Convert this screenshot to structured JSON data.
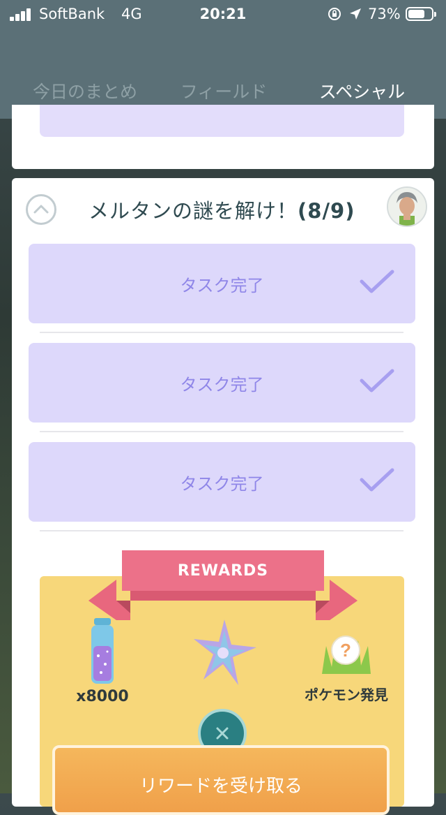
{
  "status_bar": {
    "carrier": "SoftBank",
    "network": "4G",
    "time": "20:21",
    "battery_percent": "73%",
    "battery_level": 0.73
  },
  "tabs": [
    {
      "label": "今日のまとめ",
      "active": false
    },
    {
      "label": "フィールド",
      "active": false
    },
    {
      "label": "スペシャル",
      "active": true
    }
  ],
  "quest": {
    "title": "メルタンの謎を解け！",
    "progress": "(8/9)",
    "tasks": [
      {
        "label": "タスク完了",
        "completed": true
      },
      {
        "label": "タスク完了",
        "completed": true
      },
      {
        "label": "タスク完了",
        "completed": true
      }
    ]
  },
  "rewards": {
    "banner": "REWARDS",
    "items": [
      {
        "icon": "stardust-bottle-icon",
        "label": "x8000"
      },
      {
        "icon": "rare-candy-star-icon",
        "label": ""
      },
      {
        "icon": "mystery-encounter-icon",
        "label": "ポケモン発見"
      }
    ],
    "claim_label": "リワードを受け取る"
  },
  "colors": {
    "header": "#5b7077",
    "task_bg": "#ddd8fb",
    "task_text": "#8f86e8",
    "rewards_bg": "#f7d77a",
    "ribbon": "#e8677e",
    "claim": "#f0a04a",
    "close": "#2a7f82"
  }
}
